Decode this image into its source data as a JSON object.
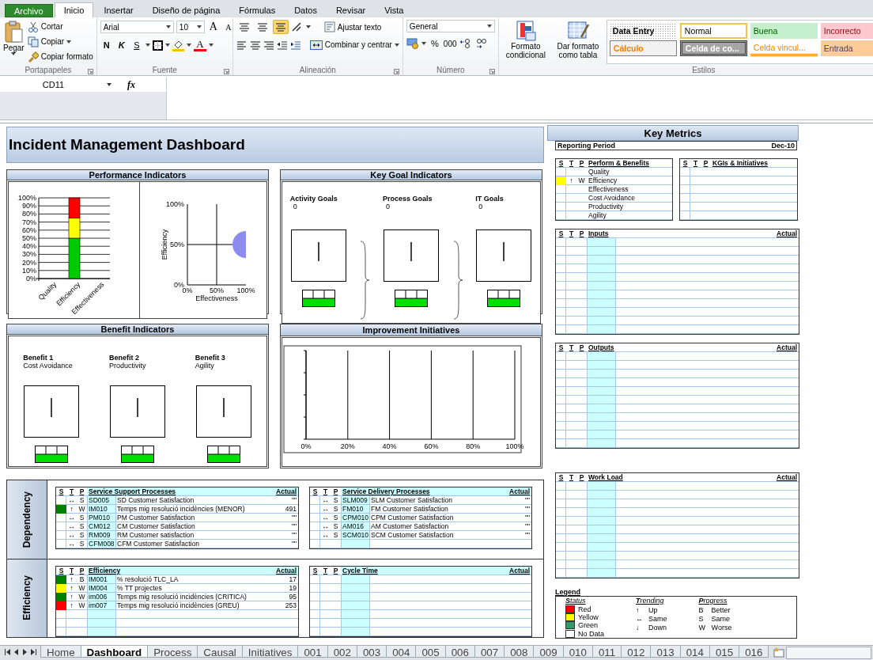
{
  "ribbon": {
    "tabs": [
      {
        "label": "Archivo",
        "kind": "file",
        "selected": false
      },
      {
        "label": "Inicio",
        "kind": "tab",
        "selected": true
      },
      {
        "label": "Insertar",
        "kind": "tab",
        "selected": false
      },
      {
        "label": "Diseño de página",
        "kind": "tab",
        "selected": false
      },
      {
        "label": "Fórmulas",
        "kind": "tab",
        "selected": false
      },
      {
        "label": "Datos",
        "kind": "tab",
        "selected": false
      },
      {
        "label": "Revisar",
        "kind": "tab",
        "selected": false
      },
      {
        "label": "Vista",
        "kind": "tab",
        "selected": false
      }
    ],
    "clipboard": {
      "label": "Portapapeles",
      "paste": "Pegar",
      "cut": "Cortar",
      "copy": "Copiar",
      "format_painter": "Copiar formato"
    },
    "font": {
      "label": "Fuente",
      "family": "Arial",
      "size": "10",
      "grow": "A",
      "shrink": "A",
      "bold": "N",
      "italic": "K",
      "underline": "S",
      "color_button": "A"
    },
    "alignment": {
      "label": "Alineación",
      "vertical_align": [
        {
          "selected": false
        },
        {
          "selected": false
        },
        {
          "selected": true
        }
      ],
      "wrap": "Ajustar texto",
      "merge": "Combinar y centrar"
    },
    "number": {
      "label": "Número",
      "format": "General",
      "percent": "%",
      "thousands": "000"
    },
    "styles": {
      "label": "Estilos",
      "conditional": "Formato condicional",
      "as_table": "Dar formato como tabla",
      "cell_styles": [
        {
          "label": "Data Entry",
          "kind": "dataentry"
        },
        {
          "label": "Normal",
          "kind": "normal"
        },
        {
          "label": "Buena",
          "kind": "good"
        },
        {
          "label": "Incorrecto",
          "kind": "bad"
        },
        {
          "label": "Cálculo",
          "kind": "calc"
        },
        {
          "label": "Celda de co...",
          "kind": "check"
        },
        {
          "label": "Celda vincul...",
          "kind": "linked"
        },
        {
          "label": "Entrada",
          "kind": "input"
        }
      ]
    }
  },
  "formula_bar": {
    "name_box": "CD11",
    "fx": "fx"
  },
  "dashboard": {
    "title": "Incident Management Dashboard",
    "performance": {
      "title": "Performance Indicators",
      "bar_chart": {
        "chart_data": {
          "type": "bar",
          "stacked": true,
          "grid": true,
          "ylim": [
            0,
            1
          ],
          "categories": [
            "Quality",
            "Efficiency",
            "Effectiveness"
          ],
          "series": [
            {
              "color": "#00cc00",
              "values": [
                0,
                0.5,
                0
              ]
            },
            {
              "color": "#ffff00",
              "values": [
                0,
                0.25,
                0
              ]
            },
            {
              "color": "#ff0000",
              "values": [
                0,
                0.25,
                0
              ]
            }
          ],
          "yticks": [
            {
              "value": 0,
              "label": "0%"
            },
            {
              "value": 0.1,
              "label": "10%"
            },
            {
              "value": 0.2,
              "label": "20%"
            },
            {
              "value": 0.3,
              "label": "30%"
            },
            {
              "value": 0.4,
              "label": "40%"
            },
            {
              "value": 0.5,
              "label": "50%"
            },
            {
              "value": 0.6,
              "label": "60%"
            },
            {
              "value": 0.7,
              "label": "70%"
            },
            {
              "value": 0.8,
              "label": "80%"
            },
            {
              "value": 0.9,
              "label": "90%"
            },
            {
              "value": 1,
              "label": "100%"
            }
          ]
        }
      },
      "bubble_chart": {
        "chart_data": {
          "type": "scatter",
          "grid": true,
          "xlim": [
            0,
            1
          ],
          "ylim": [
            0,
            1
          ],
          "xlabel": "Effectiveness",
          "ylabel": "Efficiency",
          "x": [
            1
          ],
          "series": [
            {
              "color": "#8c8cf0",
              "values": [
                0.5
              ]
            }
          ],
          "xticks": [
            {
              "value": 0,
              "label": "0%"
            },
            {
              "value": 0.5,
              "label": "50%"
            },
            {
              "value": 1,
              "label": "100%"
            }
          ],
          "yticks": [
            {
              "value": 0,
              "label": "0%"
            },
            {
              "value": 0.5,
              "label": "50%"
            },
            {
              "value": 1,
              "label": "100%"
            }
          ]
        }
      }
    },
    "kgi": {
      "title": "Key Goal Indicators",
      "goals": [
        {
          "label": "Activity Goals",
          "value": "0"
        },
        {
          "label": "Process Goals",
          "value": "0"
        },
        {
          "label": "IT Goals",
          "value": "0"
        }
      ]
    },
    "benefits": {
      "title": "Benefit Indicators",
      "items": [
        {
          "label": "Benefit 1",
          "name": "Cost Avoidance"
        },
        {
          "label": "Benefit 2",
          "name": "Productivity"
        },
        {
          "label": "Benefit 3",
          "name": "Agility"
        }
      ]
    },
    "initiatives": {
      "title": "Improvement Initiatives",
      "chart_data": {
        "type": "bar",
        "orientation": "horizontal",
        "grid": true,
        "xlim": [
          0,
          1
        ],
        "categories": [
          null,
          null,
          null,
          null
        ],
        "values": [
          null,
          null,
          null,
          null
        ],
        "xticks": [
          {
            "value": 0,
            "label": "0%"
          },
          {
            "value": 0.2,
            "label": "20%"
          },
          {
            "value": 0.4,
            "label": "40%"
          },
          {
            "value": 0.6,
            "label": "60%"
          },
          {
            "value": 0.8,
            "label": "80%"
          },
          {
            "value": 1,
            "label": "100%"
          }
        ]
      }
    },
    "sections": [
      {
        "label": "Dependency",
        "tables": [
          {
            "columns": [
              "S",
              "T",
              "P",
              "Service Support Processes",
              "Actual"
            ],
            "rows": [
              {
                "trend": "↔",
                "progress": "S",
                "code": "SD005",
                "name": "SD Customer Satisfaction",
                "actual": "\"\""
              },
              {
                "color": "#008000",
                "trend": "↑",
                "progress": "W",
                "code": "IM010",
                "name": "Temps mig resolució incidències (MENOR)",
                "actual": "491"
              },
              {
                "trend": "↔",
                "progress": "S",
                "code": "PM010",
                "name": "PM Customer Satisfaction",
                "actual": "\"\""
              },
              {
                "trend": "↔",
                "progress": "S",
                "code": "CM012",
                "name": "CM Customer Satisfaction",
                "actual": "\"\""
              },
              {
                "trend": "↔",
                "progress": "S",
                "code": "RM009",
                "name": "RM Customer satisfaction",
                "actual": "\"\""
              },
              {
                "trend": "↔",
                "progress": "S",
                "code": "CFM008",
                "name": "CFM Customer Satisfaction",
                "actual": "\"\""
              }
            ]
          },
          {
            "columns": [
              "S",
              "T",
              "P",
              "Service Delivery Processes",
              "Actual"
            ],
            "rows": [
              {
                "trend": "↔",
                "progress": "S",
                "code": "SLM009",
                "name": "SLM Customer Satisfaction",
                "actual": "\"\""
              },
              {
                "trend": "↔",
                "progress": "S",
                "code": "FM010",
                "name": "FM Customer Satisfaction",
                "actual": "\"\""
              },
              {
                "trend": "↔",
                "progress": "S",
                "code": "CPM010",
                "name": "CPM Customer Satisfaction",
                "actual": "\"\""
              },
              {
                "trend": "↔",
                "progress": "S",
                "code": "AM016",
                "name": "AM Customer Satisfaction",
                "actual": "\"\""
              },
              {
                "trend": "↔",
                "progress": "S",
                "code": "SCM010",
                "name": "SCM Customer Satisfaction",
                "actual": "\"\""
              }
            ]
          }
        ]
      },
      {
        "label": "Efficiency",
        "tables": [
          {
            "columns": [
              "S",
              "T",
              "P",
              "Efficiency",
              "Actual"
            ],
            "rows": [
              {
                "color": "#008000",
                "trend": "↑",
                "progress": "B",
                "code": "IM001",
                "name": "% resolució TLC_LA",
                "actual": "17"
              },
              {
                "color": "#ffff00",
                "trend": "↑",
                "progress": "W",
                "code": "IM004",
                "name": "% TT projectes",
                "actual": "19"
              },
              {
                "color": "#008000",
                "trend": "↑",
                "progress": "W",
                "code": "im006",
                "name": "Temps mig resolució incidències (CRITICA)",
                "actual": "95"
              },
              {
                "color": "#ff0000",
                "trend": "↑",
                "progress": "W",
                "code": "im007",
                "name": "Temps mig resolució incidències (GREU)",
                "actual": "253"
              }
            ]
          },
          {
            "columns": [
              "S",
              "T",
              "P",
              "Cycle Time",
              "Actual"
            ]
          }
        ]
      }
    ]
  },
  "key_metrics": {
    "title": "Key Metrics",
    "period_label": "Reporting Period",
    "period": "Dec-10",
    "perform": {
      "columns": [
        "S",
        "T",
        "P",
        "Perform & Benefits"
      ],
      "rows": [
        {
          "name": "Quality"
        },
        {
          "color": "#ffff00",
          "trend": "↑",
          "progress": "W",
          "name": "Efficiency"
        },
        {
          "name": "Effectiveness"
        },
        {
          "name": "Cost Avoidance"
        },
        {
          "name": "Productivity"
        },
        {
          "name": "Agility"
        }
      ]
    },
    "kgis": {
      "columns": [
        "S",
        "T",
        "P",
        "KGIs & Initiatives"
      ]
    },
    "inputs": {
      "columns": [
        "S",
        "T",
        "P",
        "Inputs",
        "Actual"
      ]
    },
    "outputs": {
      "columns": [
        "S",
        "T",
        "P",
        "Outputs",
        "Actual"
      ]
    },
    "workload": {
      "columns": [
        "S",
        "T",
        "P",
        "Work Load",
        "Actual"
      ]
    }
  },
  "legend": {
    "title": "Legend",
    "status": {
      "heading": "**S**tatus",
      "items": [
        {
          "label": "Red",
          "color": "#ff0000"
        },
        {
          "label": "Yellow",
          "color": "#ffff00"
        },
        {
          "label": "Green",
          "color": "#339966"
        },
        {
          "label": "No Data",
          "color": "#ffffff"
        }
      ]
    },
    "trending": {
      "heading": "**T**rending",
      "items": [
        {
          "symbol": "↑",
          "label": "Up"
        },
        {
          "symbol": "↔",
          "label": "Same"
        },
        {
          "symbol": "↓",
          "label": "Down"
        }
      ]
    },
    "progress": {
      "heading": "**P**rogress",
      "items": [
        {
          "symbol": "B",
          "label": "Better"
        },
        {
          "symbol": "S",
          "label": "Same"
        },
        {
          "symbol": "W",
          "label": "Worse"
        }
      ]
    }
  },
  "sheet_tabs": [
    {
      "label": "Home",
      "selected": false
    },
    {
      "label": "Dashboard",
      "selected": true
    },
    {
      "label": "Process",
      "selected": false
    },
    {
      "label": "Causal",
      "selected": false
    },
    {
      "label": "Initiatives",
      "selected": false
    },
    {
      "label": "001",
      "selected": false
    },
    {
      "label": "002",
      "selected": false
    },
    {
      "label": "003",
      "selected": false
    },
    {
      "label": "004",
      "selected": false
    },
    {
      "label": "005",
      "selected": false
    },
    {
      "label": "006",
      "selected": false
    },
    {
      "label": "007",
      "selected": false
    },
    {
      "label": "008",
      "selected": false
    },
    {
      "label": "009",
      "selected": false
    },
    {
      "label": "010",
      "selected": false
    },
    {
      "label": "011",
      "selected": false
    },
    {
      "label": "012",
      "selected": false
    },
    {
      "label": "013",
      "selected": false
    },
    {
      "label": "014",
      "selected": false
    },
    {
      "label": "015",
      "selected": false
    },
    {
      "label": "016",
      "selected": false
    }
  ]
}
